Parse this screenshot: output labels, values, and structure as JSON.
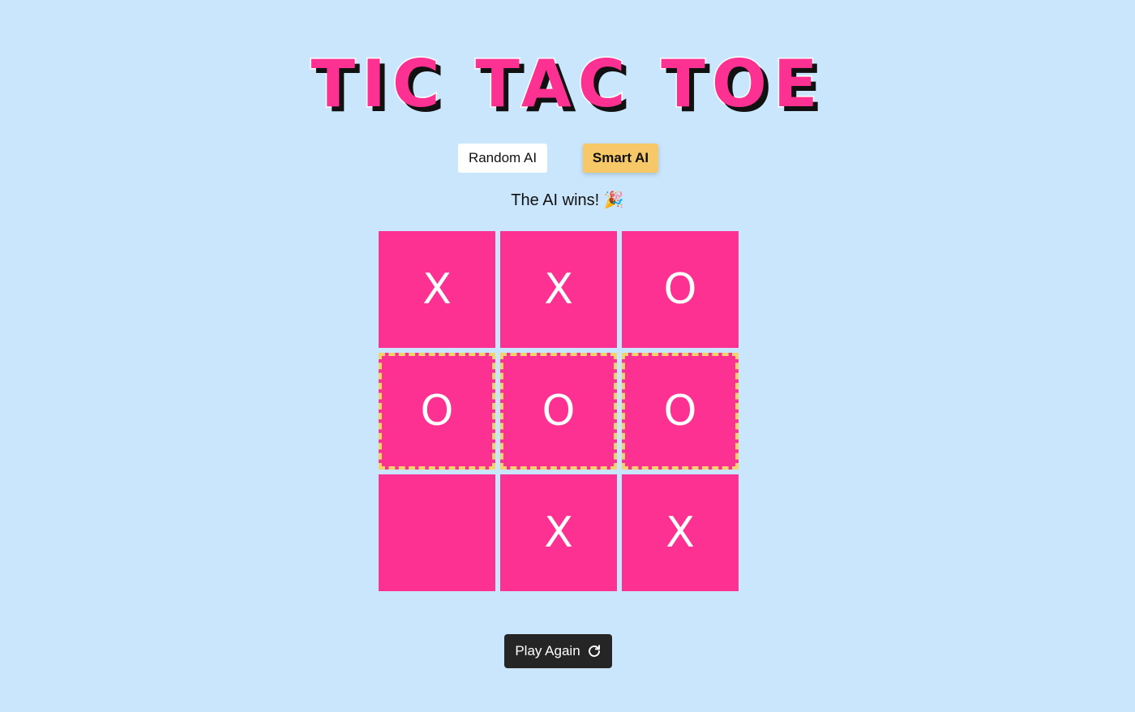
{
  "title": "TIC TAC TOE",
  "modes": {
    "random_label": "Random AI",
    "smart_label": "Smart AI",
    "selected": "Smart AI"
  },
  "status": "The AI wins! 🎉",
  "board": {
    "cells": [
      "X",
      "X",
      "O",
      "O",
      "O",
      "O",
      "",
      "X",
      "X"
    ],
    "winning_cells": [
      3,
      4,
      5
    ]
  },
  "actions": {
    "play_again_label": "Play Again",
    "play_again_icon": "refresh-icon"
  },
  "colors": {
    "background": "#cae6fd",
    "cell": "#fd3191",
    "title": "#fd3191",
    "selected_mode": "#f6c867",
    "win_highlight": "#f6d36a",
    "play_again_bg": "#252525"
  }
}
